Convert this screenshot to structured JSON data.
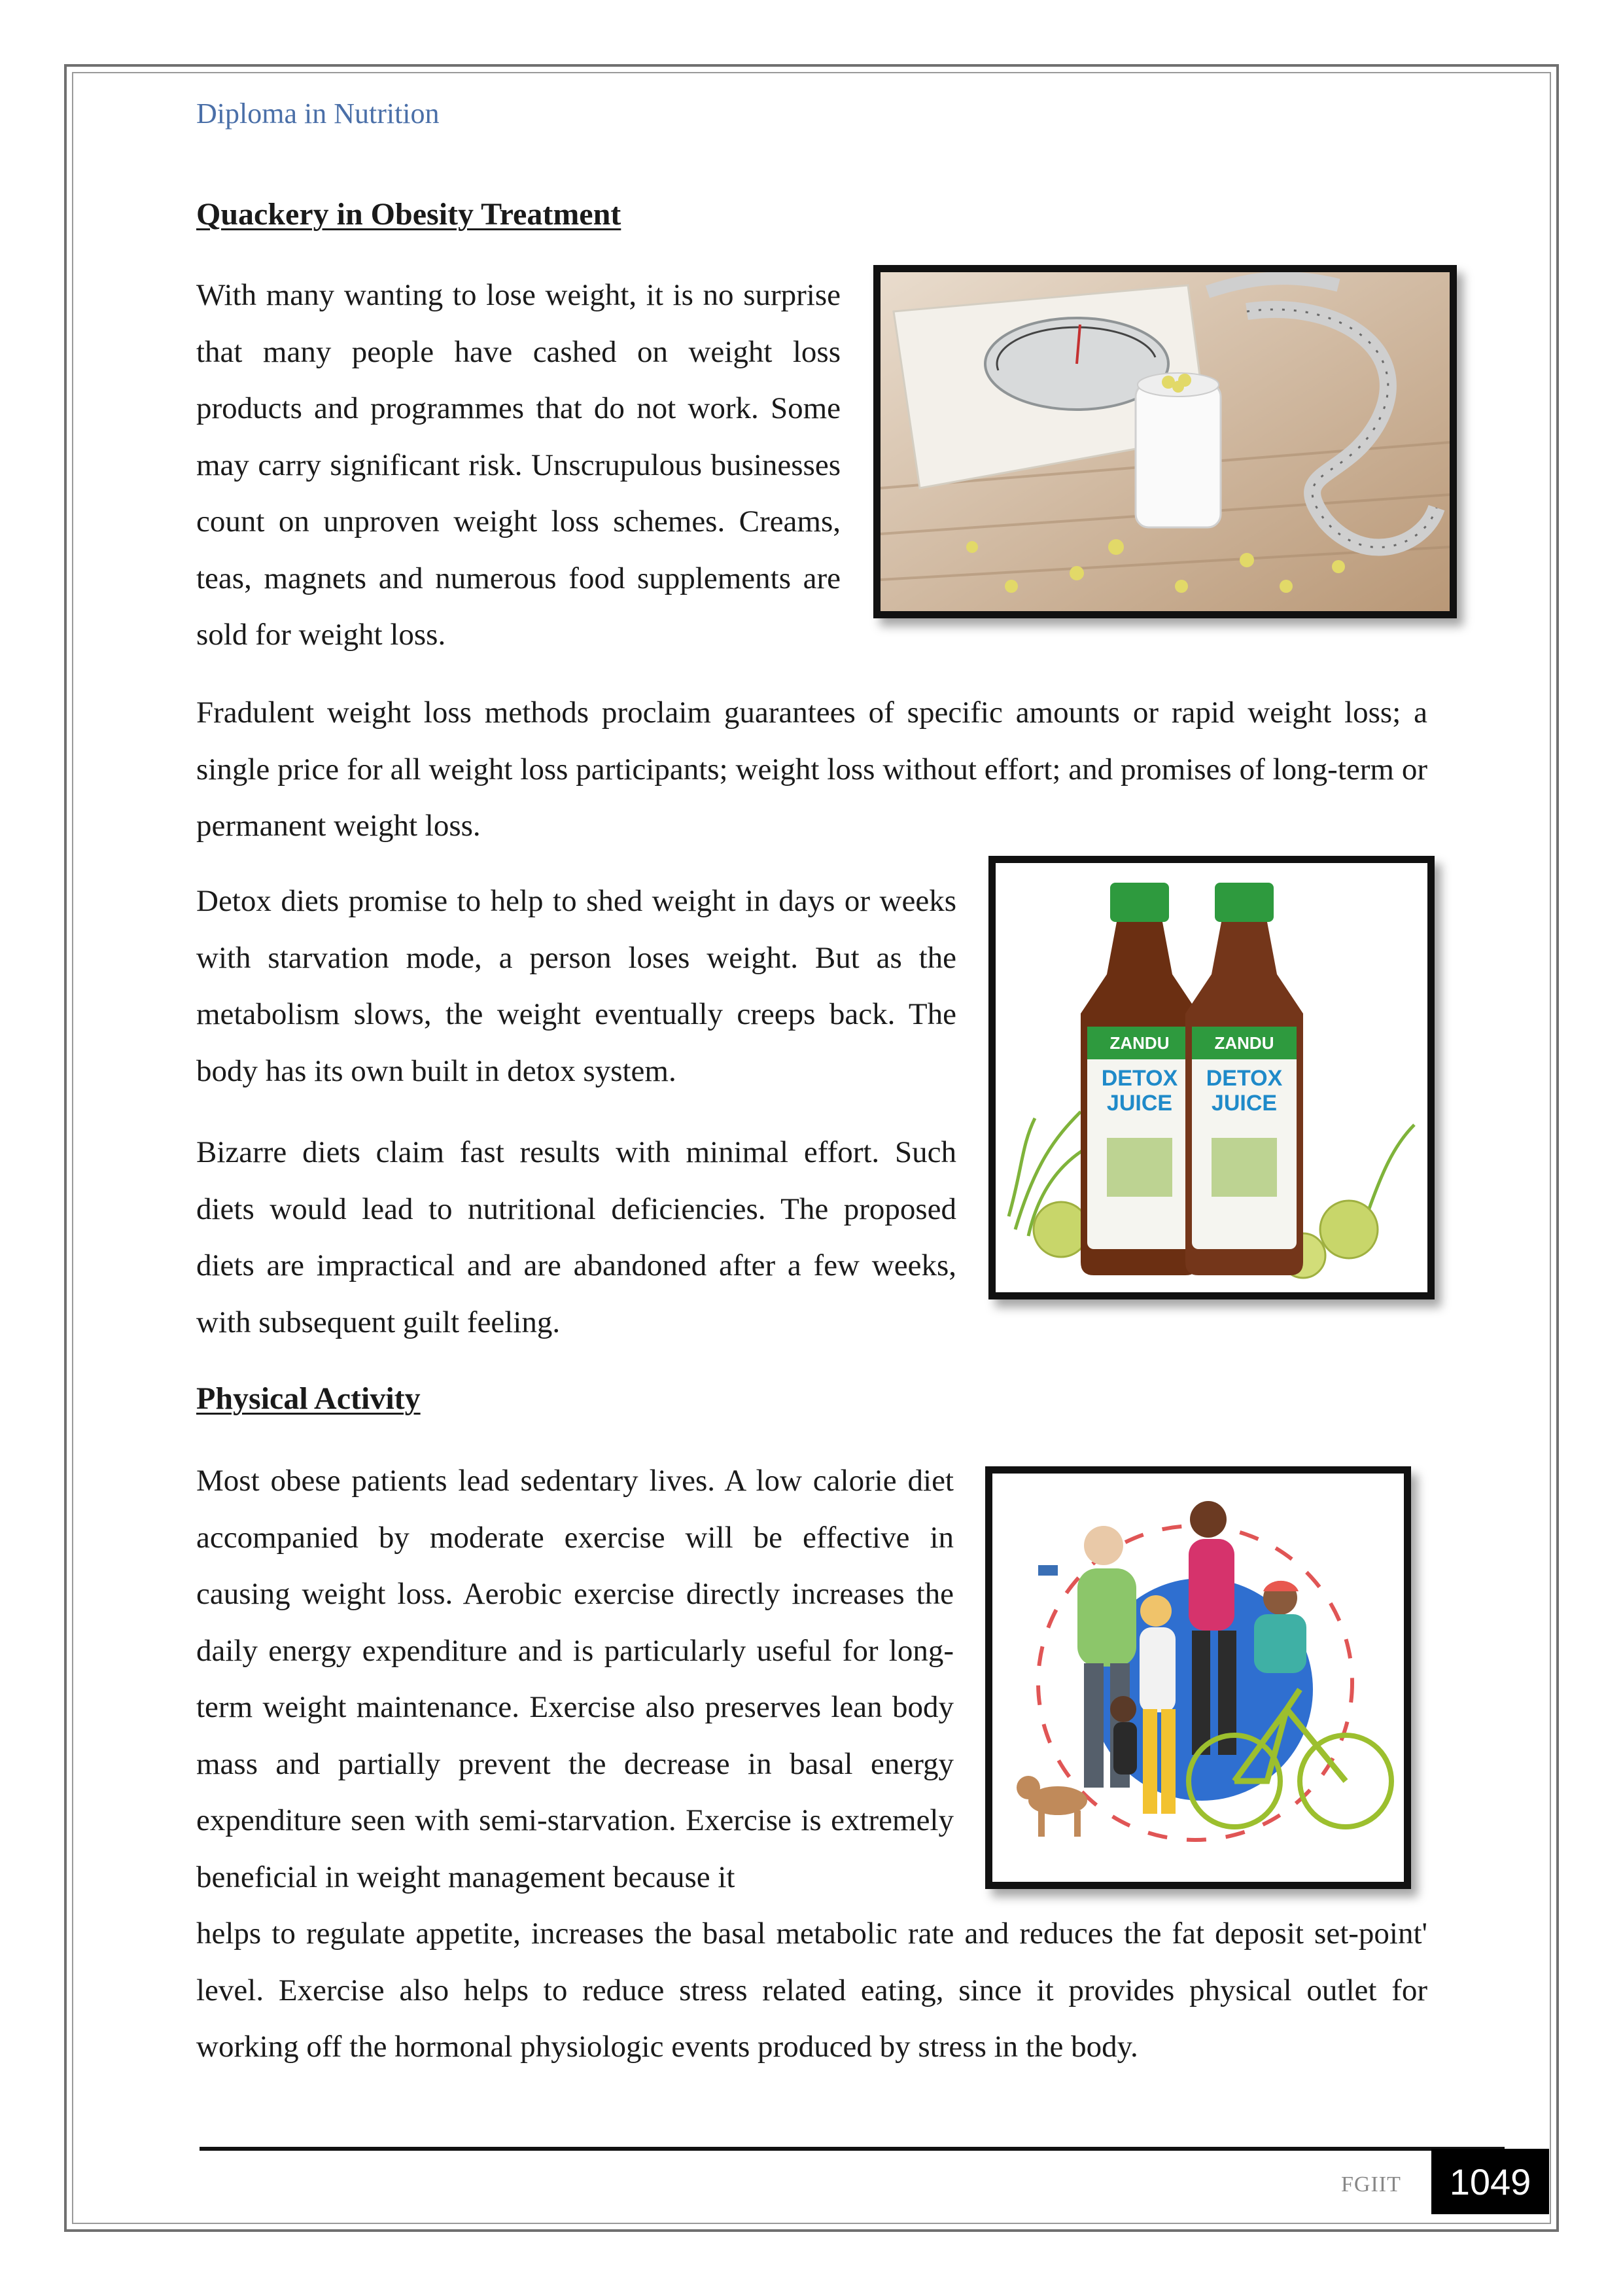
{
  "header": {
    "running_title": "Diploma in Nutrition"
  },
  "section1": {
    "heading": "Quackery in Obesity Treatment",
    "paragraphs": [
      "With many wanting to lose weight, it is no surprise that many people have cashed on weight loss products and programmes that do not work. Some may carry significant risk. Unscrupulous businesses count on unproven weight loss schemes. Creams, teas, magnets and numerous food supplements are sold for weight loss.",
      "Fradulent weight loss methods proclaim guarantees of specific amounts or rapid weight loss; a single price for all weight loss participants; weight loss without effort; and promises of long-term or permanent weight loss.",
      "Detox diets promise to help to shed weight in days or weeks with starvation mode, a person loses weight. But as the metabolism slows, the weight eventually creeps back. The body has its own built in detox system.",
      "Bizarre diets claim fast results with minimal effort. Such diets would lead to nutritional deficiencies. The proposed diets are impractical and are abandoned after a few weeks, with subsequent guilt feeling."
    ]
  },
  "section2": {
    "heading": "Physical Activity",
    "paragraph_wrapped": "Most obese patients lead sedentary lives. A low calorie diet accompanied by moderate exercise will be effective in causing weight loss. Aerobic exercise directly increases the daily energy expenditure and is particularly useful for long-term weight maintenance. Exercise also preserves lean body mass and partially prevent the decrease in basal energy expenditure seen with semi-starvation. Exercise is extremely beneficial in weight management because it",
    "paragraph_full": "helps to regulate appetite, increases the basal metabolic rate and reduces the fat deposit set-point' level. Exercise also helps to reduce stress related eating, since it provides physical outlet for working off the hormonal physiologic events produced by stress in the body."
  },
  "figures": {
    "detox_bottle_brand": "ZANDU",
    "detox_bottle_label_line1": "DETOX",
    "detox_bottle_label_line2": "JUICE"
  },
  "footer": {
    "org": "FGIIT",
    "page_number": "1049"
  },
  "colors": {
    "header_blue": "#4a6fa8",
    "bottle_cap_green": "#2e9a3e",
    "juice_brown": "#6b2f12"
  }
}
